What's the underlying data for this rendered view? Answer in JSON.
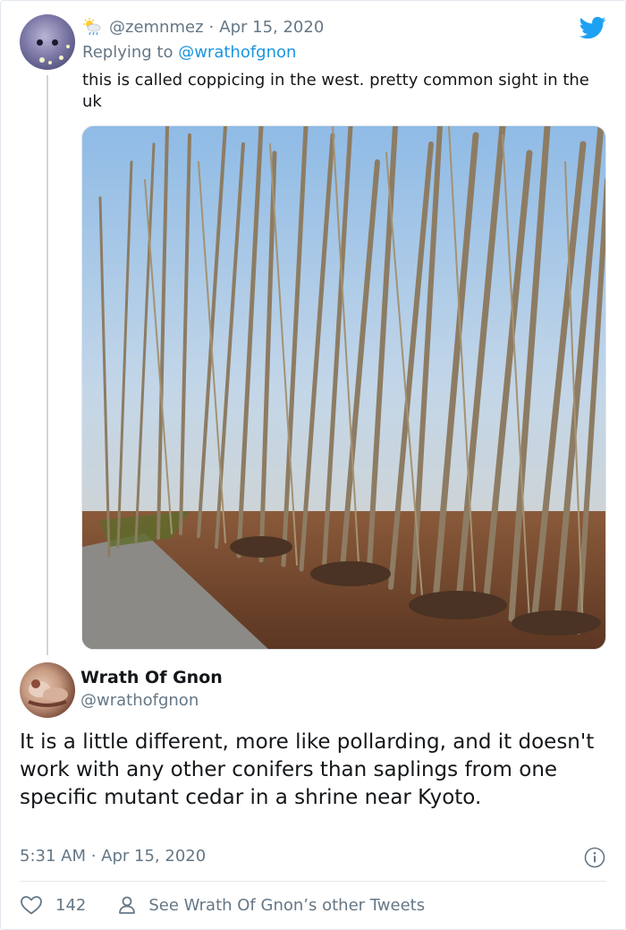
{
  "reply": {
    "handle": "@zemnmez",
    "separator": "·",
    "date": "Apr 15, 2020",
    "replying_prefix": "Replying to ",
    "replying_to": "@wrathofgnon",
    "text": "this is called coppicing in the west. pretty common  sight in the uk",
    "icons": {
      "status": "sun-behind-rain-cloud-icon",
      "brand": "twitter-bird-icon"
    }
  },
  "main_tweet": {
    "author_name": "Wrath Of Gnon",
    "author_handle": "@wrathofgnon",
    "text": "It is a little different, more like pollarding, and it doesn't work with any other conifers than saplings from one specific mutant cedar in a shrine near Kyoto.",
    "timestamp": "5:31 AM · Apr 15, 2020",
    "likes": "142",
    "see_more_label": "See Wrath Of Gnon’s other Tweets"
  },
  "colors": {
    "twitter_blue": "#1da1f2",
    "link_blue": "#1b95e0",
    "secondary_text": "#657786",
    "primary_text": "#14171a",
    "border": "#e1e8ed"
  }
}
